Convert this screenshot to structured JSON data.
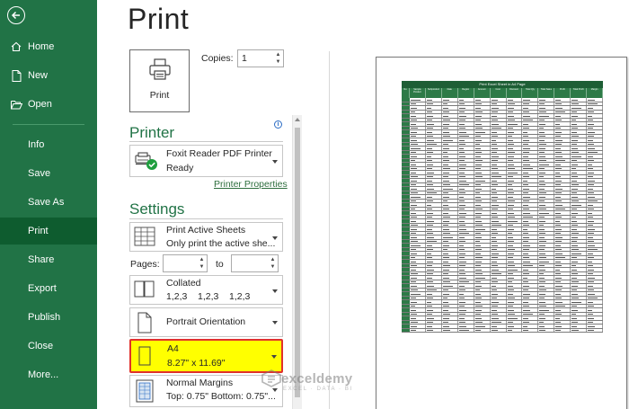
{
  "sidebar": {
    "items": [
      {
        "label": "Home",
        "icon": "home-icon"
      },
      {
        "label": "New",
        "icon": "new-file-icon"
      },
      {
        "label": "Open",
        "icon": "open-folder-icon"
      },
      {
        "label": "Info"
      },
      {
        "label": "Save"
      },
      {
        "label": "Save As"
      },
      {
        "label": "Print"
      },
      {
        "label": "Share"
      },
      {
        "label": "Export"
      },
      {
        "label": "Publish"
      },
      {
        "label": "Close"
      },
      {
        "label": "More..."
      }
    ],
    "active": "Print",
    "color": "#217346",
    "active_color": "#0e5c2f"
  },
  "page": {
    "title": "Print"
  },
  "print_button": {
    "label": "Print"
  },
  "copies": {
    "label": "Copies:",
    "value": "1"
  },
  "printer": {
    "heading": "Printer",
    "name": "Foxit Reader PDF Printer",
    "status": "Ready",
    "properties_link": "Printer Properties"
  },
  "settings": {
    "heading": "Settings",
    "sheets": {
      "line1": "Print Active Sheets",
      "line2": "Only print the active she..."
    },
    "pages": {
      "label": "Pages:",
      "to_label": "to"
    },
    "collation": {
      "line1": "Collated",
      "line2": "1,2,3    1,2,3    1,2,3"
    },
    "orientation": {
      "line1": "Portrait Orientation"
    },
    "paper": {
      "line1": "A4",
      "line2": "8.27\" x 11.69\"",
      "highlight_color": "#ffff00"
    },
    "margins": {
      "line1": "Normal Margins",
      "line2": "Top: 0.75\" Bottom: 0.75\"..."
    }
  },
  "preview": {
    "sheet_title": "Print Excel Sheet in A4 Page",
    "columns": [
      "No",
      "Sample Product",
      "Subproduct",
      "Date",
      "Region",
      "Amount",
      "Cost",
      "Discount",
      "Total Qty",
      "Total Sales",
      "Profit",
      "Total Profit",
      "Margin"
    ]
  },
  "watermark": {
    "name": "exceldemy",
    "tagline": "EXCEL · DATA · BI"
  }
}
